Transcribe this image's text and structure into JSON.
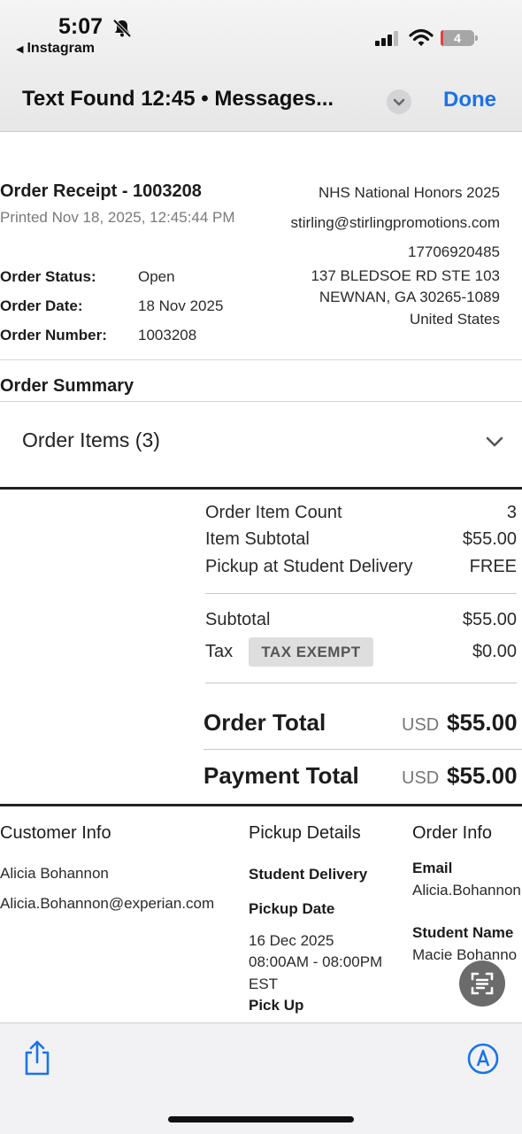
{
  "status_bar": {
    "time": "5:07",
    "back_app": "Instagram",
    "battery": "4"
  },
  "nav": {
    "title": "Text Found 12:45 • Messages...",
    "done_label": "Done"
  },
  "receipt": {
    "title": "Order Receipt - 1003208",
    "printed": "Printed Nov 18, 2025, 12:45:44 PM",
    "status_label": "Order Status:",
    "status_value": "Open",
    "date_label": "Order Date:",
    "date_value": "18 Nov 2025",
    "number_label": "Order Number:",
    "number_value": "1003208"
  },
  "vendor": {
    "name": "NHS National Honors 2025",
    "email": "stirling@stirlingpromotions.com",
    "phone": "17706920485",
    "address1": "137 BLEDSOE RD STE 103",
    "address2": "NEWNAN, GA 30265-1089",
    "country": "United States"
  },
  "summary": {
    "heading": "Order Summary",
    "items_toggle": "Order Items (3)",
    "item_count_label": "Order Item Count",
    "item_count_value": "3",
    "item_subtotal_label": "Item Subtotal",
    "item_subtotal_value": "$55.00",
    "pickup_label": "Pickup at Student Delivery",
    "pickup_value": "FREE",
    "subtotal_label": "Subtotal",
    "subtotal_value": "$55.00",
    "tax_label": "Tax",
    "tax_badge": "TAX EXEMPT",
    "tax_value": "$0.00",
    "order_total_label": "Order Total",
    "order_total_currency": "USD",
    "order_total_value": "$55.00",
    "payment_total_label": "Payment Total",
    "payment_total_currency": "USD",
    "payment_total_value": "$55.00"
  },
  "customer": {
    "heading": "Customer Info",
    "name": "Alicia Bohannon",
    "email": "Alicia.Bohannon@experian.com"
  },
  "pickup": {
    "heading": "Pickup Details",
    "method": "Student Delivery",
    "date_label": "Pickup Date",
    "date": "16 Dec 2025",
    "time": "08:00AM - 08:00PM",
    "tz": "EST",
    "pickup_label": "Pick Up"
  },
  "order_info": {
    "heading": "Order Info",
    "email_label": "Email",
    "email_value": "Alicia.Bohannon",
    "student_label": "Student Name",
    "student_value": "Macie Bohanno"
  },
  "icons": {
    "bell": "bell-slash-icon",
    "signal": "cellular-signal-icon",
    "wifi": "wifi-icon",
    "chevron": "chevron-down-icon",
    "ocr": "text-scan-icon",
    "share": "share-icon",
    "markup": "markup-pen-icon"
  },
  "colors": {
    "accent": "#1a73e8"
  }
}
